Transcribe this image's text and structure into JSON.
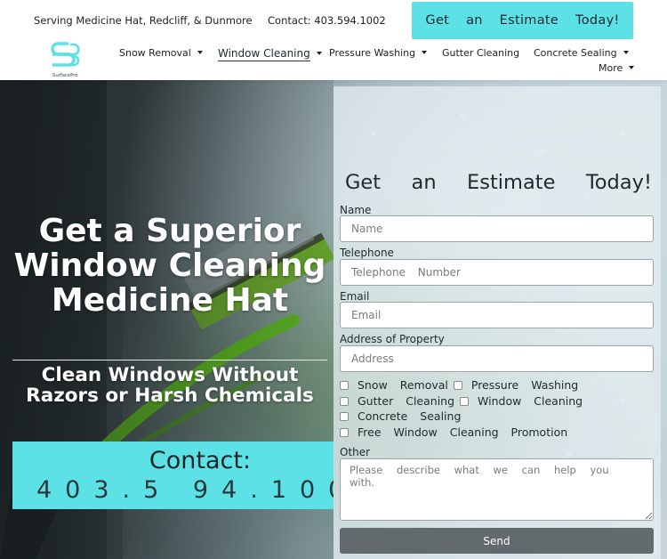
{
  "topbar": {
    "tagline": "Serving Medicine Hat, Redcliff, & Dunmore",
    "contact": "Contact: 403.594.1002",
    "cta_label": "Get an Estimate Today!"
  },
  "brand": {
    "logo_text": "SurfacePro",
    "accent_color": "#5ce1e6"
  },
  "nav": {
    "items": [
      {
        "label": "Snow Removal",
        "dropdown": true
      },
      {
        "label": "Window Cleaning",
        "dropdown": true,
        "active": true
      },
      {
        "label": "Pressure Washing",
        "dropdown": true
      },
      {
        "label": "Gutter Cleaning",
        "dropdown": false
      },
      {
        "label": "Concrete Sealing",
        "dropdown": true
      },
      {
        "label": "More",
        "dropdown": true
      }
    ]
  },
  "hero": {
    "title": "Get a Superior Window Cleaning Medicine Hat",
    "subtitle": "Clean Windows Without Razors or Harsh Chemicals",
    "contact_label": "Contact:",
    "contact_phone": "403.5 94.100"
  },
  "form": {
    "title_words": [
      "Get",
      "an",
      "Estimate",
      "Today!"
    ],
    "name_label": "Name",
    "name_placeholder": "Name",
    "phone_label": "Telephone",
    "phone_placeholder": "Telephone Number",
    "email_label": "Email",
    "email_placeholder": "Email",
    "address_label": "Address of Property",
    "address_placeholder": "Address",
    "services": [
      "Snow Removal",
      "Pressure Washing",
      "Gutter Cleaning",
      "Window Cleaning",
      "Concrete Sealing",
      "Free Window Cleaning Promotion"
    ],
    "other_label": "Other",
    "other_placeholder": "Please describe what we can help you with.",
    "send_label": "Send"
  }
}
